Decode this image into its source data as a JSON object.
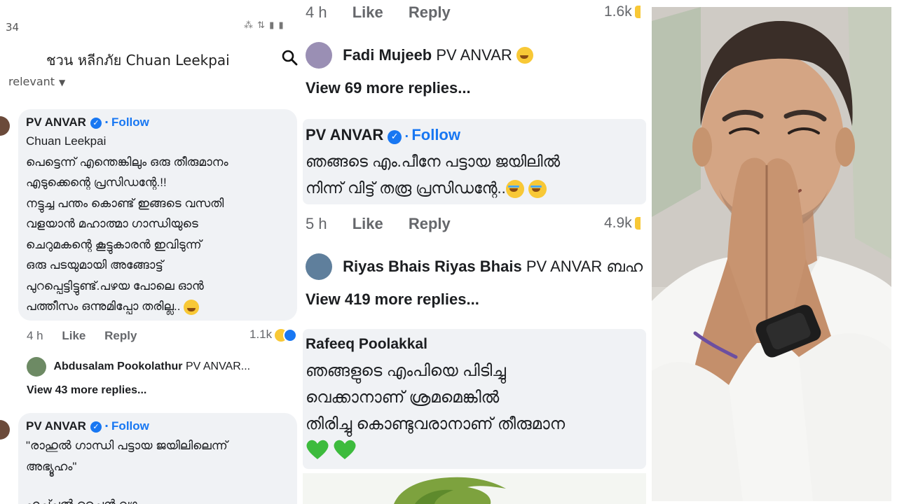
{
  "left": {
    "status_time": "34",
    "status_icons": "⁂ ⇅ ▮ ▮",
    "header_title": "ชวน หลีกภัย Chuan Leekpai",
    "sort_label": "relevant",
    "comment1": {
      "name": "PV ANVAR",
      "follow": "Follow",
      "text": "Chuan Leekpai\nപെട്ടെന്ന് എന്തെങ്കിലും ഒരു തീരുമാനം\nഎടുക്കെന്റെ പ്രസിഡന്റേ.!!\nനട്ടുച്ച പന്തം കൊണ്ട് ഇങ്ങടെ വസതി\nവളയാൻ മഹാത്മാ ഗാന്ധിയുടെ\nചെറുമകന്റെ കൂട്ടുകാരൻ ഇവിടുന്ന്\nഒരു പടയുമായി അങ്ങോട്ട്\nപുറപ്പെട്ടിട്ടുണ്ട്.പഴയ പോലെ ഓൻ\nപത്തീസം ഒന്നുമിപ്പോ തരില്ല..",
      "time": "4 h",
      "like": "Like",
      "reply": "Reply",
      "count": "1.1k"
    },
    "reply1": {
      "name": "Abdusalam Pookolathur",
      "text": "PV ANVAR..."
    },
    "view_more1": "View 43 more replies...",
    "comment2": {
      "name": "PV ANVAR",
      "follow": "Follow",
      "text": "\"രാഹുൽ ഗാന്ധി പട്ടായ ജയിലിലെന്ന്\nഅഭ്യൂഹം\"",
      "cut_text": "ഹൃച്ച്ചൽ ചൈൻ വഴ"
    }
  },
  "mid": {
    "top_actions": {
      "time": "4 h",
      "like": "Like",
      "reply": "Reply",
      "count": "1.6k"
    },
    "reply_a": {
      "name": "Fadi Mujeeb",
      "text": "PV ANVAR"
    },
    "view_more_a": "View 69 more replies...",
    "comment_b": {
      "name": "PV ANVAR",
      "follow": "Follow",
      "text": "ഞങ്ങടെ എം.പീനേ പട്ടായ ജയിലിൽ\nനിന്ന് വിട്ട് തരൂ പ്രസിഡന്റേ.."
    },
    "actions_b": {
      "time": "5 h",
      "like": "Like",
      "reply": "Reply",
      "count": "4.9k"
    },
    "reply_c": {
      "name": "Riyas Bhais Riyas Bhais",
      "text": "PV ANVAR ബഹ"
    },
    "view_more_c": "View 419 more replies...",
    "comment_d": {
      "name": "Rafeeq Poolakkal",
      "text": "ഞങ്ങളുടെ എംപിയെ പിടിച്ചു\nവെക്കാനാണ് ശ്രമമെങ്കിൽ\nതിരിച്ചു കൊണ്ടുവരാനാണ് തീരുമാന"
    }
  },
  "colors": {
    "link_blue": "#1877f2",
    "bubble_bg": "#f0f2f5",
    "meta_gray": "#65676b",
    "heart_green": "#3dbb3d"
  }
}
